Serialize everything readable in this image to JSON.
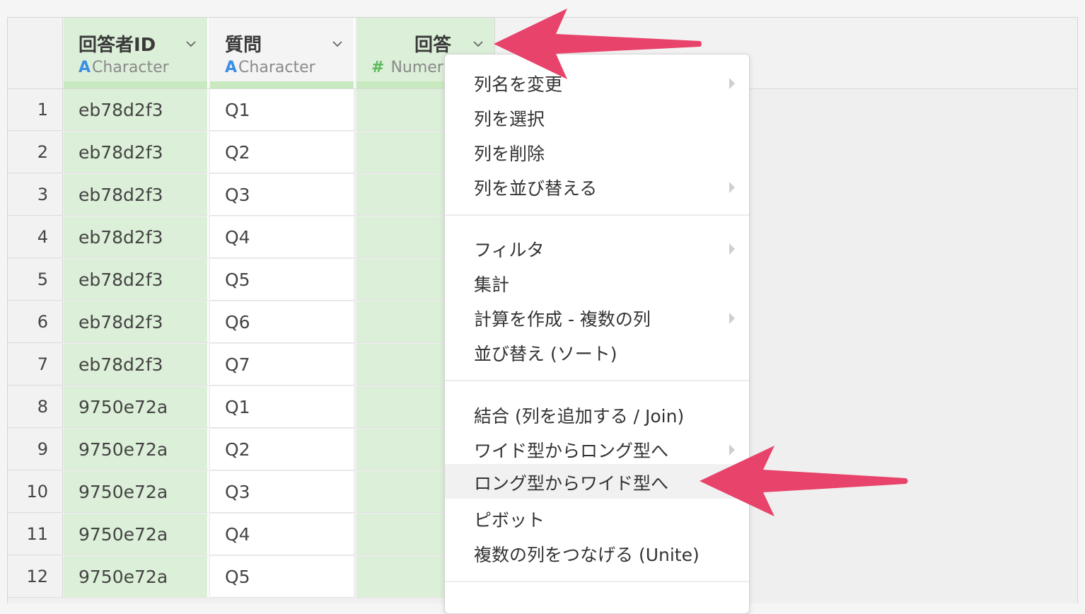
{
  "columns": [
    {
      "name": "回答者ID",
      "type_badge": "A",
      "type_label": "Character"
    },
    {
      "name": "質問",
      "type_badge": "A",
      "type_label": "Character"
    },
    {
      "name": "回答",
      "type_badge": "#",
      "type_label": "Numeric"
    }
  ],
  "rows": [
    {
      "num": "1",
      "id": "eb78d2f3",
      "q": "Q1"
    },
    {
      "num": "2",
      "id": "eb78d2f3",
      "q": "Q2"
    },
    {
      "num": "3",
      "id": "eb78d2f3",
      "q": "Q3"
    },
    {
      "num": "4",
      "id": "eb78d2f3",
      "q": "Q4"
    },
    {
      "num": "5",
      "id": "eb78d2f3",
      "q": "Q5"
    },
    {
      "num": "6",
      "id": "eb78d2f3",
      "q": "Q6"
    },
    {
      "num": "7",
      "id": "eb78d2f3",
      "q": "Q7"
    },
    {
      "num": "8",
      "id": "9750e72a",
      "q": "Q1"
    },
    {
      "num": "9",
      "id": "9750e72a",
      "q": "Q2"
    },
    {
      "num": "10",
      "id": "9750e72a",
      "q": "Q3"
    },
    {
      "num": "11",
      "id": "9750e72a",
      "q": "Q4"
    },
    {
      "num": "12",
      "id": "9750e72a",
      "q": "Q5"
    }
  ],
  "menu": {
    "groups": [
      [
        {
          "label": "列名を変更",
          "submenu": true
        },
        {
          "label": "列を選択",
          "submenu": false
        },
        {
          "label": "列を削除",
          "submenu": false
        },
        {
          "label": "列を並び替える",
          "submenu": true
        }
      ],
      [
        {
          "label": "フィルタ",
          "submenu": true
        },
        {
          "label": "集計",
          "submenu": false
        },
        {
          "label": "計算を作成 - 複数の列",
          "submenu": true
        },
        {
          "label": "並び替え (ソート)",
          "submenu": false
        }
      ],
      [
        {
          "label": "結合 (列を追加する / Join)",
          "submenu": false
        },
        {
          "label": "ワイド型からロング型へ",
          "submenu": true
        },
        {
          "label": "ロング型からワイド型へ",
          "submenu": false,
          "highlighted": true
        },
        {
          "label": "ピボット",
          "submenu": false
        },
        {
          "label": "複数の列をつなげる (Unite)",
          "submenu": false
        }
      ]
    ]
  },
  "colors": {
    "character_badge": "#3a8ee6",
    "numeric_badge": "#5cb85c",
    "arrow": "#e8436b"
  }
}
